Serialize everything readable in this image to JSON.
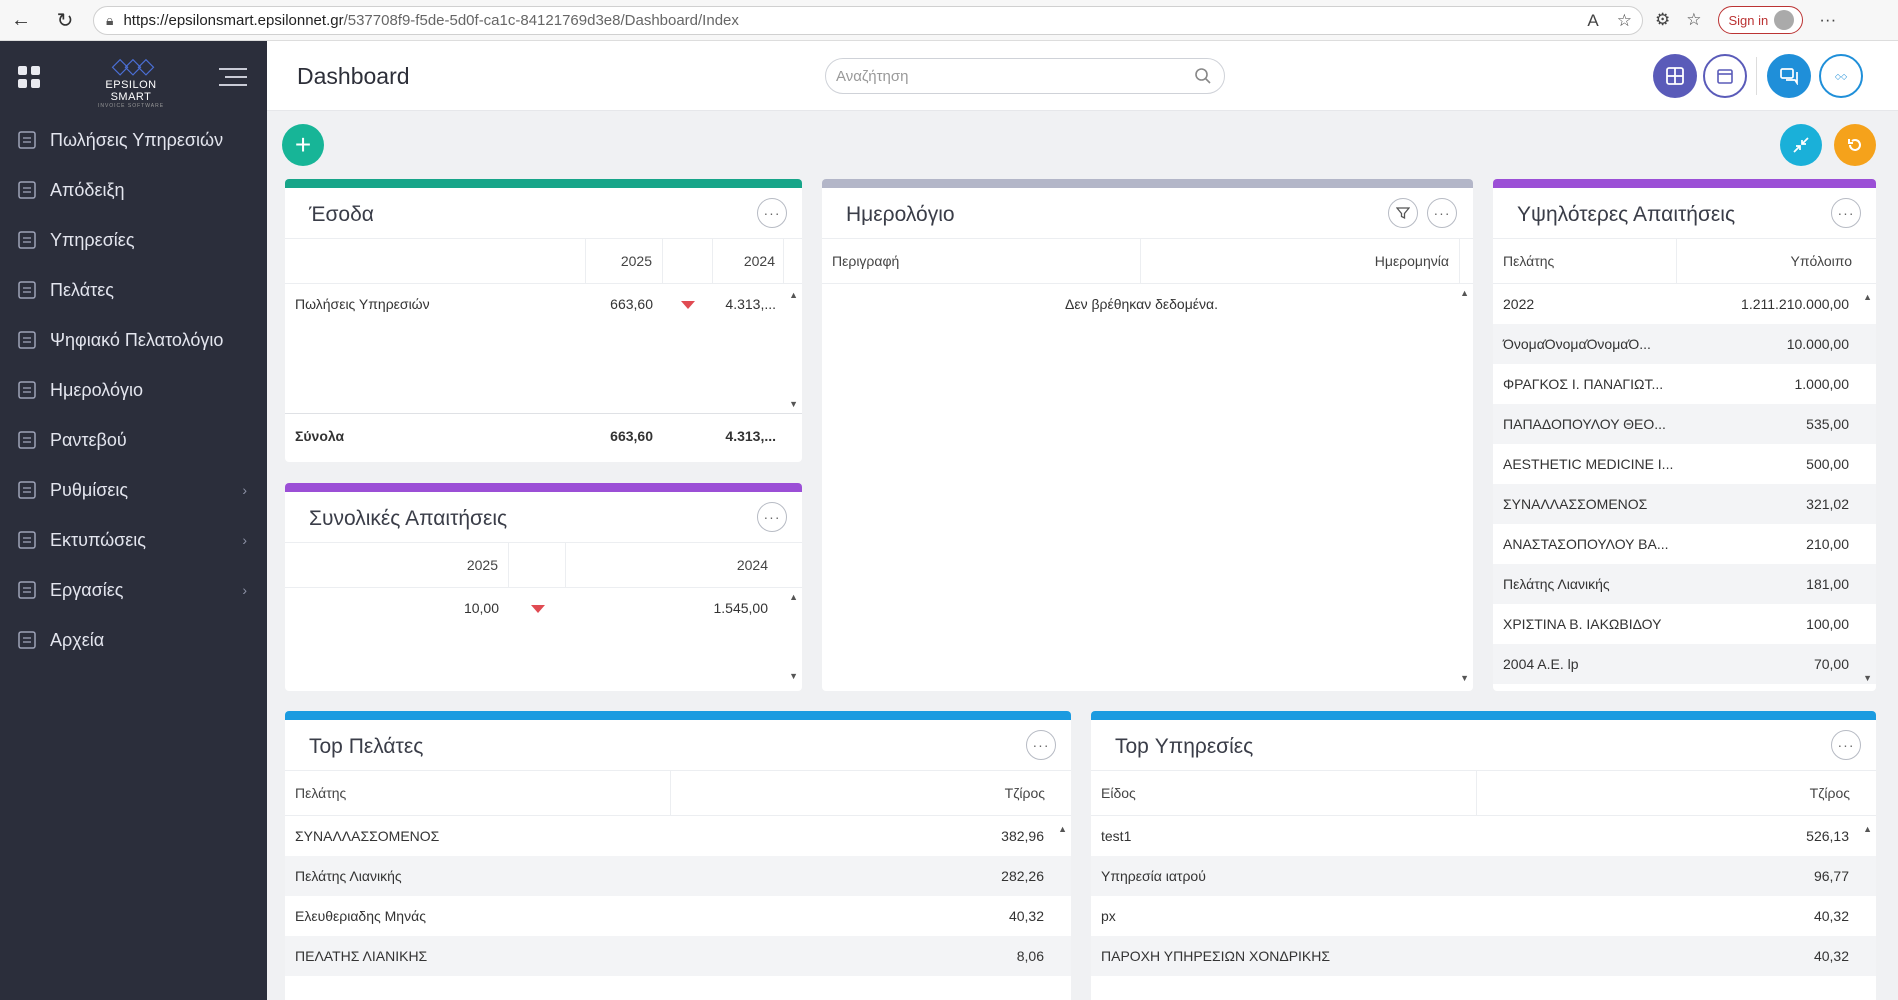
{
  "browser": {
    "url_host": "https://epsilonsmart.epsilonnet.gr",
    "url_path": "/537708f9-f5de-5d0f-ca1c-84121769d3e8/Dashboard/Index",
    "signin_label": "Sign in"
  },
  "sidebar": {
    "logo_text": "EPSILON SMART",
    "logo_sub": "INVOICE SOFTWARE",
    "items": [
      {
        "label": "Πωλήσεις Υπηρεσιών",
        "icon": "coins-icon"
      },
      {
        "label": "Απόδειξη",
        "icon": "receipt-icon"
      },
      {
        "label": "Υπηρεσίες",
        "icon": "services-icon"
      },
      {
        "label": "Πελάτες",
        "icon": "users-icon"
      },
      {
        "label": "Ψηφιακό Πελατολόγιο",
        "icon": "digital-registry-icon"
      },
      {
        "label": "Ημερολόγιο",
        "icon": "calendar-icon"
      },
      {
        "label": "Ραντεβού",
        "icon": "appointment-icon"
      },
      {
        "label": "Ρυθμίσεις",
        "icon": "gear-icon",
        "chevron": "›"
      },
      {
        "label": "Εκτυπώσεις",
        "icon": "print-icon",
        "chevron": "›"
      },
      {
        "label": "Εργασίες",
        "icon": "tasks-icon",
        "chevron": "›"
      },
      {
        "label": "Αρχεία",
        "icon": "files-icon"
      }
    ]
  },
  "header": {
    "title": "Dashboard",
    "search_placeholder": "Αναζήτηση"
  },
  "colors": {
    "income_accent": "#17a589",
    "calendar_accent": "#b3b6c8",
    "claims_accent": "#9b4fd6",
    "top_accent": "#1b9be0"
  },
  "income": {
    "title": "Έσοδα",
    "col_2025": "2025",
    "col_2024": "2024",
    "row_label": "Πωλήσεις Υπηρεσιών",
    "row_2025": "663,60",
    "row_2024": "4.313,...",
    "total_label": "Σύνολα",
    "total_2025": "663,60",
    "total_2024": "4.313,..."
  },
  "total_claims": {
    "title": "Συνολικές Απαιτήσεις",
    "col_2025": "2025",
    "col_2024": "2024",
    "val_2025": "10,00",
    "val_2024": "1.545,00"
  },
  "calendar": {
    "title": "Ημερολόγιο",
    "col_desc": "Περιγραφή",
    "col_date": "Ημερομηνία",
    "empty": "Δεν βρέθηκαν δεδομένα."
  },
  "highest_claims": {
    "title": "Υψηλότερες Απαιτήσεις",
    "col_customer": "Πελάτης",
    "col_balance": "Υπόλοιπο",
    "rows": [
      {
        "name": "2022",
        "value": "1.211.210.000,00"
      },
      {
        "name": "ΌνομαΌνομαΌνομαΌ...",
        "value": "10.000,00"
      },
      {
        "name": "ΦΡΑΓΚΟΣ Ι. ΠΑΝΑΓΙΩΤ...",
        "value": "1.000,00"
      },
      {
        "name": "ΠΑΠΑΔΟΠΟΥΛΟΥ ΘΕΟ...",
        "value": "535,00"
      },
      {
        "name": "AESTHETIC MEDICINE I...",
        "value": "500,00"
      },
      {
        "name": "ΣΥΝΑΛΛΑΣΣΟΜΕΝΟΣ",
        "value": "321,02"
      },
      {
        "name": "ΑΝΑΣΤΑΣΟΠΟΥΛΟΥ ΒΑ...",
        "value": "210,00"
      },
      {
        "name": "Πελάτης Λιανικής",
        "value": "181,00"
      },
      {
        "name": "ΧΡΙΣΤΙΝΑ Β. ΙΑΚΩΒΙΔΟΥ",
        "value": "100,00"
      },
      {
        "name": "2004 Α.Ε. lp",
        "value": "70,00"
      }
    ]
  },
  "top_customers": {
    "title": "Top Πελάτες",
    "col_customer": "Πελάτης",
    "col_turnover": "Τζίρος",
    "rows": [
      {
        "name": "ΣΥΝΑΛΛΑΣΣΟΜΕΝΟΣ",
        "value": "382,96"
      },
      {
        "name": "Πελάτης Λιανικής",
        "value": "282,26"
      },
      {
        "name": "Ελευθεριαδης Μηνάς",
        "value": "40,32"
      },
      {
        "name": "ΠΕΛΑΤΗΣ ΛΙΑΝΙΚΗΣ",
        "value": "8,06"
      }
    ]
  },
  "top_services": {
    "title": "Top Υπηρεσίες",
    "col_item": "Είδος",
    "col_turnover": "Τζίρος",
    "rows": [
      {
        "name": "test1",
        "value": "526,13"
      },
      {
        "name": "Υπηρεσία ιατρού",
        "value": "96,77"
      },
      {
        "name": "px",
        "value": "40,32"
      },
      {
        "name": "ΠΑΡΟΧΗ ΥΠΗΡΕΣΙΩΝ ΧΟΝΔΡΙΚΗΣ",
        "value": "40,32"
      }
    ]
  }
}
